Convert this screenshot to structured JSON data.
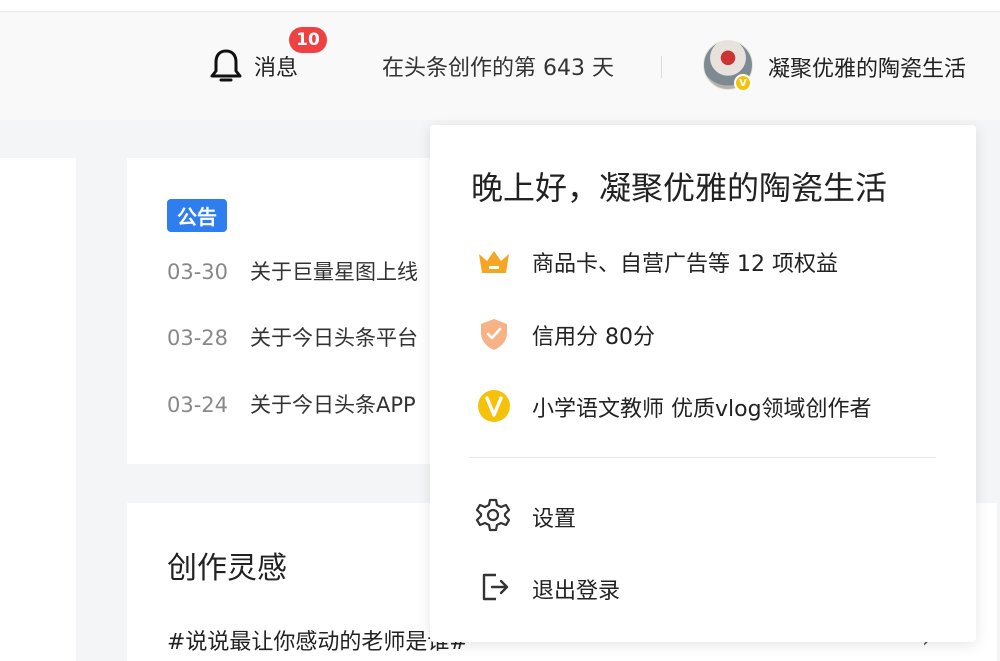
{
  "header": {
    "messages_label": "消息",
    "messages_badge": "10",
    "days_text": "在头条创作的第 643 天",
    "username": "凝聚优雅的陶瓷生活"
  },
  "notices": {
    "tag": "公告",
    "items": [
      {
        "date": "03-30",
        "title": "关于巨量星图上线"
      },
      {
        "date": "03-28",
        "title": "关于今日头条平台"
      },
      {
        "date": "03-24",
        "title": "关于今日头条APP"
      }
    ]
  },
  "inspiration": {
    "title": "创作灵感",
    "first_item": "#说说最让你感动的老师是谁#",
    "arrow": "›"
  },
  "dropdown": {
    "greeting": "晚上好，凝聚优雅的陶瓷生活",
    "benefits_text": "商品卡、自营广告等 12 项权益",
    "credit_text": "信用分  80分",
    "verified_text": "小学语文教师 优质vlog领域创作者",
    "settings_label": "设置",
    "logout_label": "退出登录"
  },
  "colors": {
    "accent_blue": "#2f7ef0",
    "badge_red": "#f04142",
    "crown_orange": "#f5a623",
    "shield_peach": "#f7b285",
    "verified_yellow": "#f5c20a"
  },
  "icons": {
    "bell": "bell-icon",
    "crown": "crown-icon",
    "shield": "shield-check-icon",
    "verified": "verified-v-icon",
    "settings": "gear-icon",
    "logout": "logout-icon"
  }
}
